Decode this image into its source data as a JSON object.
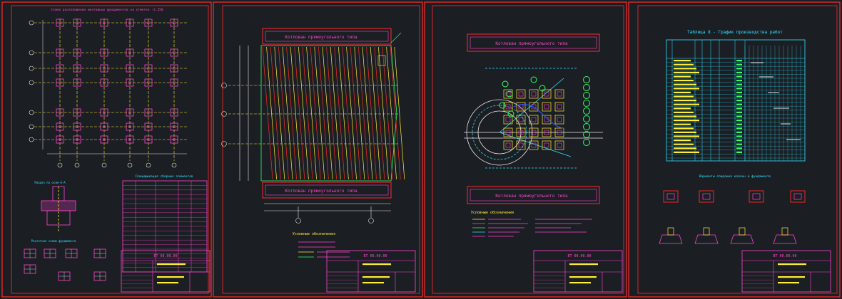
{
  "sheets": [
    {
      "id": "sheet-1",
      "title": "Схема расположения монтажных фундаментов на отметке -2.250",
      "spec_title": "Спецификация сборных элементов",
      "section_title": "Разрез по осям А-А",
      "detail_title": "Расчетная схема фундамента",
      "stamp_code": "ВТ 00.00.00",
      "stamp_sheet": "1"
    },
    {
      "id": "sheet-2",
      "label_top": "Котлован прямоугольного типа",
      "label_bottom": "Котлован прямоугольного типа",
      "legend_title": "Условные обозначения",
      "stamp_code": "ВТ 00.00.00",
      "stamp_sheet": "2"
    },
    {
      "id": "sheet-3",
      "label_top": "Котлован прямоугольного типа",
      "label_bottom": "Котлован прямоугольного типа",
      "legend_title": "Условные обозначения",
      "stamp_code": "ВТ 00.00.00",
      "stamp_sheet": "3"
    },
    {
      "id": "sheet-4",
      "table_title": "Таблица 8 - График производства работ",
      "details_title": "Варианты опирания колонн в фундаменте",
      "stamp_code": "ВТ 00.00.00",
      "stamp_sheet": "4"
    }
  ],
  "colors": {
    "background": "#1b1f24",
    "frame": "#ff2a2a",
    "grid_yellow": "#ffee33",
    "magenta": "#ff44cc",
    "cyan": "#33e0ff",
    "green": "#33ff66",
    "white": "#e8e8e8"
  }
}
